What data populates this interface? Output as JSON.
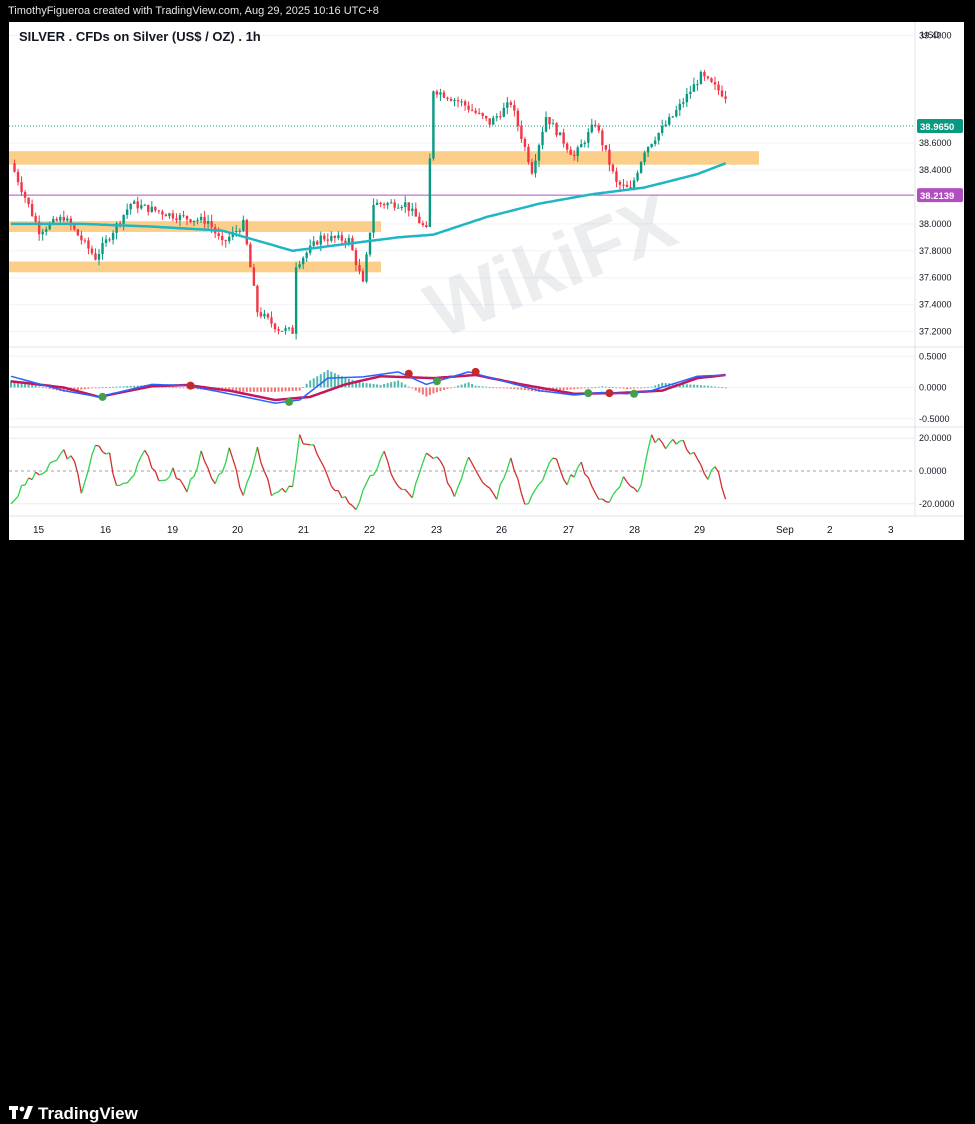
{
  "header": {
    "attribution": "TimothyFigueroa created with TradingView.com, Aug 29, 2025 10:16 UTC+8"
  },
  "symbol": {
    "title": "SILVER . CFDs on Silver (US$ / OZ) . 1h",
    "currency": "USD"
  },
  "footer": {
    "brand": "TradingView"
  },
  "watermark": {
    "text": "WikiFX"
  },
  "colors": {
    "bull": "#089981",
    "bear": "#f23645",
    "ema": "#1fb5c4",
    "zone": "#fbcf8a",
    "level": "#b24fc0",
    "green_line": "#2fd14a"
  },
  "chart_data": [
    {
      "type": "candlestick",
      "ylim": [
        37.1,
        39.5
      ],
      "y_ticks": [
        "39.4000",
        "38.6000",
        "38.4000",
        "38.0000",
        "37.8000",
        "37.6000",
        "37.4000",
        "37.2000"
      ],
      "x_ticks": [
        "15",
        "16",
        "19",
        "20",
        "21",
        "22",
        "23",
        "26",
        "27",
        "28",
        "29",
        "Sep",
        "2",
        "3"
      ],
      "last_price": "38.9650",
      "level_price": "38.2139",
      "level_value": 38.2139,
      "resistance_zones": [
        [
          38.44,
          38.54
        ],
        [
          37.94,
          38.02
        ],
        [
          37.64,
          37.72
        ]
      ],
      "path_anchors": [
        [
          0,
          38.45
        ],
        [
          8,
          37.95
        ],
        [
          15,
          38.05
        ],
        [
          24,
          37.75
        ],
        [
          34,
          38.15
        ],
        [
          48,
          38.05
        ],
        [
          56,
          38.02
        ],
        [
          60,
          37.85
        ],
        [
          66,
          38.0
        ],
        [
          70,
          37.35
        ],
        [
          76,
          37.22
        ],
        [
          80,
          37.2
        ],
        [
          81,
          37.7
        ],
        [
          88,
          37.9
        ],
        [
          96,
          37.88
        ],
        [
          100,
          37.55
        ],
        [
          103,
          38.15
        ],
        [
          112,
          38.15
        ],
        [
          118,
          37.95
        ],
        [
          120,
          39.0
        ],
        [
          128,
          38.9
        ],
        [
          136,
          38.75
        ],
        [
          142,
          38.9
        ],
        [
          148,
          38.4
        ],
        [
          152,
          38.8
        ],
        [
          160,
          38.5
        ],
        [
          166,
          38.75
        ],
        [
          172,
          38.3
        ],
        [
          176,
          38.25
        ],
        [
          180,
          38.55
        ],
        [
          188,
          38.8
        ],
        [
          196,
          39.1
        ],
        [
          203,
          38.95
        ]
      ],
      "ema_anchors": [
        [
          0,
          38.0
        ],
        [
          20,
          38.0
        ],
        [
          40,
          37.98
        ],
        [
          60,
          37.95
        ],
        [
          80,
          37.8
        ],
        [
          95,
          37.85
        ],
        [
          110,
          37.9
        ],
        [
          120,
          37.92
        ],
        [
          135,
          38.05
        ],
        [
          150,
          38.15
        ],
        [
          165,
          38.22
        ],
        [
          180,
          38.27
        ],
        [
          195,
          38.37
        ],
        [
          203,
          38.45
        ]
      ]
    },
    {
      "type": "macd",
      "ylim": [
        -0.6,
        0.6
      ],
      "y_ticks": [
        "0.5000",
        "0.0000",
        "-0.5000"
      ],
      "macd_anchors": [
        [
          0,
          0.18
        ],
        [
          15,
          -0.05
        ],
        [
          25,
          -0.15
        ],
        [
          40,
          0.05
        ],
        [
          50,
          0.03
        ],
        [
          62,
          -0.1
        ],
        [
          75,
          -0.25
        ],
        [
          82,
          -0.2
        ],
        [
          90,
          0.15
        ],
        [
          100,
          0.17
        ],
        [
          110,
          0.25
        ],
        [
          118,
          0.05
        ],
        [
          130,
          0.25
        ],
        [
          140,
          0.1
        ],
        [
          150,
          -0.05
        ],
        [
          160,
          -0.12
        ],
        [
          168,
          -0.08
        ],
        [
          175,
          -0.1
        ],
        [
          182,
          -0.05
        ],
        [
          195,
          0.18
        ],
        [
          203,
          0.2
        ]
      ],
      "signal_anchors": [
        [
          0,
          0.1
        ],
        [
          15,
          0.0
        ],
        [
          25,
          -0.15
        ],
        [
          40,
          0.02
        ],
        [
          50,
          0.04
        ],
        [
          62,
          -0.05
        ],
        [
          75,
          -0.2
        ],
        [
          85,
          -0.15
        ],
        [
          95,
          0.05
        ],
        [
          105,
          0.18
        ],
        [
          120,
          0.15
        ],
        [
          132,
          0.2
        ],
        [
          145,
          0.05
        ],
        [
          160,
          -0.1
        ],
        [
          172,
          -0.09
        ],
        [
          185,
          -0.05
        ],
        [
          195,
          0.15
        ],
        [
          203,
          0.2
        ]
      ],
      "cross_markers": [
        [
          26,
          -0.15,
          "up"
        ],
        [
          51,
          0.03,
          "down"
        ],
        [
          79,
          -0.23,
          "up"
        ],
        [
          113,
          0.22,
          "down"
        ],
        [
          121,
          0.1,
          "up"
        ],
        [
          132,
          0.25,
          "down"
        ],
        [
          164,
          -0.09,
          "up"
        ],
        [
          170,
          -0.09,
          "down"
        ],
        [
          177,
          -0.1,
          "up"
        ]
      ]
    },
    {
      "type": "oscillator",
      "ylim": [
        -25,
        25
      ],
      "y_ticks": [
        "20.0000",
        "0.0000",
        "-20.0000"
      ],
      "anchors": [
        [
          0,
          -20
        ],
        [
          5,
          -5
        ],
        [
          10,
          0
        ],
        [
          15,
          12
        ],
        [
          18,
          5
        ],
        [
          20,
          -12
        ],
        [
          24,
          15
        ],
        [
          28,
          10
        ],
        [
          30,
          -10
        ],
        [
          34,
          -5
        ],
        [
          38,
          15
        ],
        [
          42,
          -8
        ],
        [
          46,
          0
        ],
        [
          50,
          -12
        ],
        [
          54,
          10
        ],
        [
          58,
          -10
        ],
        [
          62,
          12
        ],
        [
          66,
          -15
        ],
        [
          70,
          15
        ],
        [
          74,
          -15
        ],
        [
          80,
          -10
        ],
        [
          82,
          20
        ],
        [
          86,
          15
        ],
        [
          90,
          -5
        ],
        [
          94,
          -15
        ],
        [
          98,
          -22
        ],
        [
          102,
          -5
        ],
        [
          106,
          10
        ],
        [
          110,
          -10
        ],
        [
          114,
          -15
        ],
        [
          118,
          10
        ],
        [
          122,
          5
        ],
        [
          126,
          -15
        ],
        [
          130,
          10
        ],
        [
          134,
          -5
        ],
        [
          138,
          -15
        ],
        [
          142,
          10
        ],
        [
          146,
          -20
        ],
        [
          150,
          -10
        ],
        [
          154,
          10
        ],
        [
          158,
          -8
        ],
        [
          162,
          5
        ],
        [
          166,
          -15
        ],
        [
          170,
          -20
        ],
        [
          174,
          -5
        ],
        [
          178,
          -15
        ],
        [
          182,
          20
        ],
        [
          186,
          15
        ],
        [
          190,
          20
        ],
        [
          194,
          10
        ],
        [
          198,
          -5
        ],
        [
          200,
          5
        ],
        [
          203,
          -15
        ]
      ]
    }
  ]
}
